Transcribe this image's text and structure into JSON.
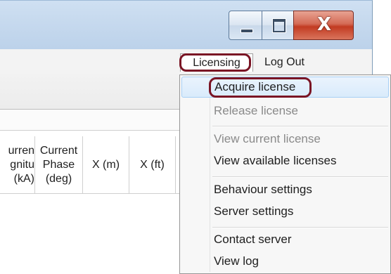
{
  "window": {
    "minimize_icon": "minimize-icon",
    "maximize_icon": "maximize-icon",
    "close_icon": "close-icon",
    "close_glyph": "X"
  },
  "menubar": {
    "licensing_label": "Licensing",
    "logout_label": "Log Out"
  },
  "table": {
    "headers": [
      "urren\ngnitu\n(kA)",
      "Current\nPhase\n(deg)",
      "X (m)",
      "X (ft)"
    ]
  },
  "licensing_menu": {
    "items": [
      {
        "label": "Acquire license",
        "enabled": true,
        "highlighted": true
      },
      {
        "label": "Release license",
        "enabled": false
      },
      {
        "label": "View current license",
        "enabled": false
      },
      {
        "label": "View available licenses",
        "enabled": true
      },
      {
        "label": "Behaviour settings",
        "enabled": true
      },
      {
        "label": "Server settings",
        "enabled": true
      },
      {
        "label": "Contact server",
        "enabled": true
      },
      {
        "label": "View log",
        "enabled": true
      }
    ]
  },
  "colors": {
    "annotation_outline": "#7a1424",
    "hover_fill": "#d9ebfb",
    "disabled_text": "#8a8a8a"
  }
}
